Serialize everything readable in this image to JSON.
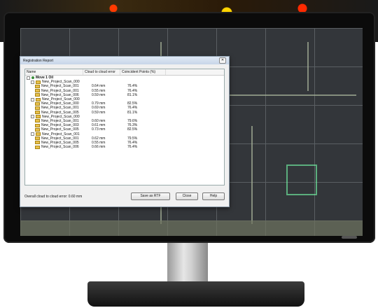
{
  "dialog": {
    "title": "Registration Report",
    "columns": [
      "Name",
      "Cloud to cloud error",
      "Coincident Points (%)"
    ],
    "rows": [
      {
        "level": 0,
        "kind": "move",
        "name": "Move 1 Oil",
        "err": "",
        "pts": ""
      },
      {
        "level": 1,
        "kind": "group",
        "name": "New_Project_Scan_000",
        "err": "",
        "pts": ""
      },
      {
        "level": 2,
        "kind": "item",
        "name": "New_Project_Scan_001",
        "err": "0.64 mm",
        "pts": "76.4%"
      },
      {
        "level": 2,
        "kind": "item",
        "name": "New_Project_Scan_001",
        "err": "0.55 mm",
        "pts": "76.4%"
      },
      {
        "level": 2,
        "kind": "item",
        "name": "New_Project_Scan_006",
        "err": "0.59 mm",
        "pts": "81.1%"
      },
      {
        "level": 1,
        "kind": "group",
        "name": "New_Project_Scan_000",
        "err": "",
        "pts": ""
      },
      {
        "level": 2,
        "kind": "item",
        "name": "New_Project_Scan_000",
        "err": "0.79 mm",
        "pts": "82.5%"
      },
      {
        "level": 2,
        "kind": "item",
        "name": "New_Project_Scan_001",
        "err": "0.69 mm",
        "pts": "76.4%"
      },
      {
        "level": 2,
        "kind": "item",
        "name": "New_Project_Scan_005",
        "err": "0.59 mm",
        "pts": "81.1%"
      },
      {
        "level": 1,
        "kind": "group",
        "name": "New_Project_Scan_000",
        "err": "",
        "pts": ""
      },
      {
        "level": 2,
        "kind": "item",
        "name": "New_Project_Scan_001",
        "err": "0.60 mm",
        "pts": "79.6%"
      },
      {
        "level": 2,
        "kind": "item",
        "name": "New_Project_Scan_003",
        "err": "0.61 mm",
        "pts": "76.3%"
      },
      {
        "level": 2,
        "kind": "item",
        "name": "New_Project_Scan_005",
        "err": "0.73 mm",
        "pts": "82.5%"
      },
      {
        "level": 1,
        "kind": "group",
        "name": "New_Project_Scan_001",
        "err": "",
        "pts": ""
      },
      {
        "level": 2,
        "kind": "item",
        "name": "New_Project_Scan_001",
        "err": "0.62 mm",
        "pts": "79.5%"
      },
      {
        "level": 2,
        "kind": "item",
        "name": "New_Project_Scan_005",
        "err": "0.55 mm",
        "pts": "76.4%"
      },
      {
        "level": 2,
        "kind": "item",
        "name": "New_Project_Scan_006",
        "err": "0.66 mm",
        "pts": "76.4%"
      }
    ],
    "footer_text": "Overall cloud to cloud error: 0.60 mm",
    "buttons": {
      "save": "Save as RTF",
      "close": "Close",
      "help": "Help"
    }
  }
}
